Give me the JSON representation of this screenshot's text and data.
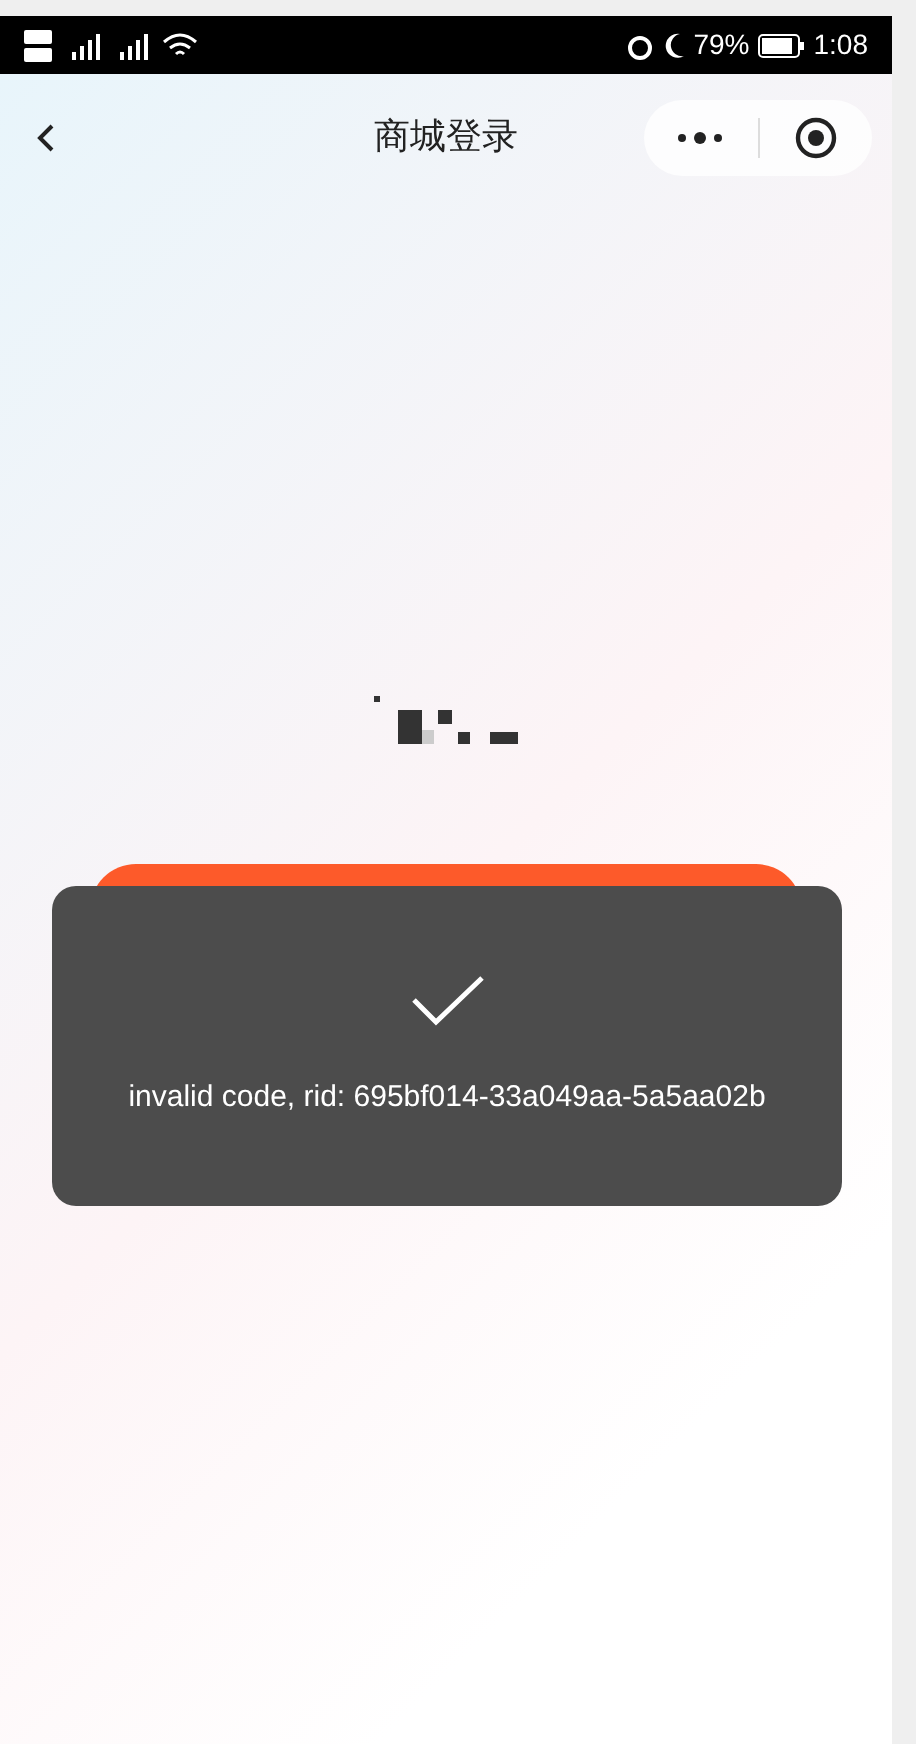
{
  "status_bar": {
    "battery": "79%",
    "time": "1:08"
  },
  "nav": {
    "title": "商城登录"
  },
  "toast": {
    "message": "invalid code, rid: 695bf014-33a049aa-5a5aa02b"
  }
}
